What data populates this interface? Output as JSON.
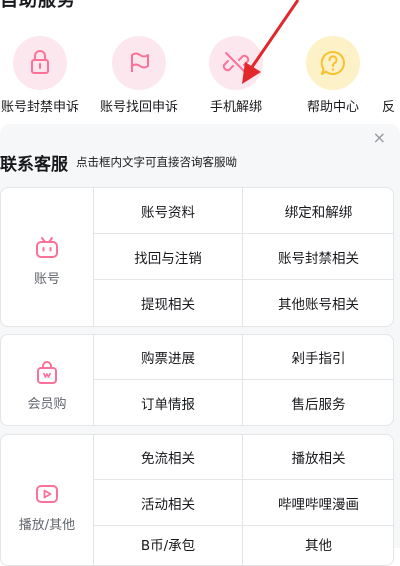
{
  "self_service": {
    "title": "自助服务",
    "items": [
      {
        "label": "账号封禁申诉",
        "icon": "lock-icon"
      },
      {
        "label": "账号找回申诉",
        "icon": "flag-icon"
      },
      {
        "label": "手机解绑",
        "icon": "unlink-icon"
      },
      {
        "label": "帮助中心",
        "icon": "question-bubble-icon"
      },
      {
        "label": "反",
        "icon": "feedback-icon"
      }
    ]
  },
  "contact": {
    "title": "联系客服",
    "subtitle": "点击框内文字可直接咨询客服呦",
    "close_icon": "×",
    "categories": [
      {
        "name": "账号",
        "icon": "tv-icon",
        "topics": [
          "账号资料",
          "绑定和解绑",
          "找回与注销",
          "账号封禁相关",
          "提现相关",
          "其他账号相关"
        ]
      },
      {
        "name": "会员购",
        "icon": "shopping-bag-icon",
        "topics": [
          "购票进展",
          "剁手指引",
          "订单情报",
          "售后服务"
        ]
      },
      {
        "name": "播放/其他",
        "icon": "play-icon",
        "topics": [
          "免流相关",
          "播放相关",
          "活动相关",
          "哔哩哔哩漫画",
          "B币/承包",
          "其他"
        ]
      }
    ]
  },
  "colors": {
    "accent_pink": "#fb7299",
    "pink_bg": "#fde7ee",
    "yellow_accent": "#f6c12d",
    "yellow_bg": "#fdf1c7",
    "annotation_red": "#e0282d"
  }
}
